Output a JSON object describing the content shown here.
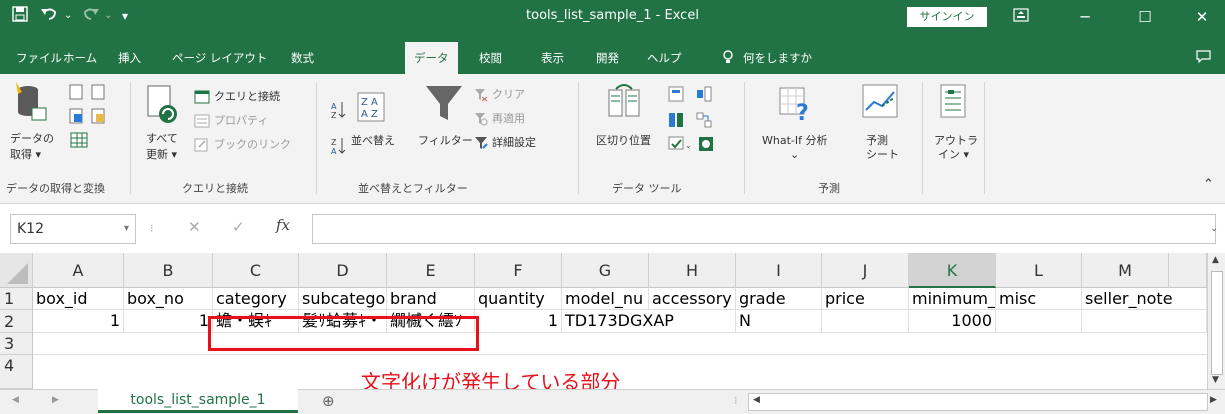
{
  "window": {
    "title": "tools_list_sample_1  -  Excel",
    "signin": "サインイン",
    "icons": [
      "save-icon",
      "undo-icon",
      "redo-icon",
      "customize-icon",
      "ribbon-display-icon",
      "minimize-icon",
      "maximize-icon",
      "close-icon"
    ]
  },
  "tabs": [
    "ファイル",
    "ホーム",
    "挿入",
    "ページ レイアウト",
    "数式",
    "データ",
    "校閲",
    "表示",
    "開発",
    "ヘルプ"
  ],
  "active_tab": "データ",
  "tell_me": "何をしますか",
  "ribbon": {
    "get_data": "データの",
    "get_data2": "取得 ▾",
    "refresh_all": "すべて",
    "refresh_all2": "更新 ▾",
    "queries": "クエリと接続",
    "properties": "プロパティ",
    "edit_links": "ブックのリンク",
    "sort": "並べ替え",
    "filter": "フィルター",
    "clear": "クリア",
    "reapply": "再適用",
    "advanced": "詳細設定",
    "text_to_columns": "区切り位置",
    "whatif": "What-If 分析",
    "whatif2": "⌄",
    "forecast": "予測",
    "forecast2": "シート",
    "outline": "アウトラ",
    "outline2": "イン ▾",
    "groups": [
      "データの取得と変換",
      "クエリと接続",
      "並べ替えとフィルター",
      "データ ツール",
      "予測"
    ]
  },
  "formula_bar": {
    "name_box": "K12",
    "name_box_arrow": "▾",
    "cancel": "✕",
    "enter": "✓",
    "fx": "fx",
    "value": ""
  },
  "sheet": {
    "columns": [
      "A",
      "B",
      "C",
      "D",
      "E",
      "F",
      "G",
      "H",
      "I",
      "J",
      "K",
      "L",
      "M"
    ],
    "rows": [
      "1",
      "2",
      "3",
      "4"
    ],
    "row1": [
      "box_id",
      "box_no",
      "category",
      "subcatego",
      "brand",
      "quantity",
      "model_nu",
      "accessory",
      "grade",
      "price",
      "minimum_",
      "misc",
      "seller_note"
    ],
    "row2": {
      "A": "1",
      "B": "1",
      "C": "蟾・蜈ｷ",
      "D": "髪ｻ蛤募ｷ・",
      "E": "繝槭く繧ｿ",
      "F": "1",
      "G": "TD173DGXAP",
      "I": "N",
      "K": "1000"
    },
    "annotation": "文字化けが発生している部分",
    "annotation_color": "#e8101a",
    "sheet_tab": "tools_list_sample_1",
    "add_sheet": "⊕"
  },
  "colors": {
    "brand": "#217346"
  }
}
